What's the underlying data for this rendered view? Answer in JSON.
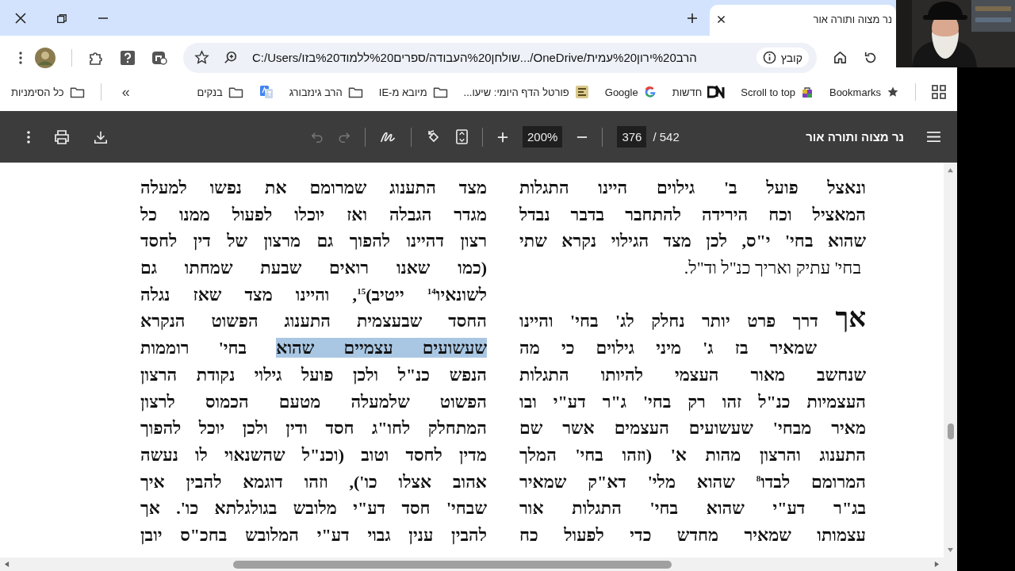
{
  "tabs": [
    {
      "title": "נר מצוה ותורה אור",
      "selected": true
    }
  ],
  "address_bar": {
    "site_chip": "קובץ",
    "url": "C:/Users/שולחן%20העבודה/ספרים%20ללמוד%20בזו.../OneDrive/הרב%20ירון%20עמית"
  },
  "bookmarks_bar": {
    "items": [
      {
        "kind": "star",
        "label": "Bookmarks"
      },
      {
        "kind": "bag",
        "label": "Scroll to top"
      },
      {
        "kind": "dn",
        "label": "חדשות"
      },
      {
        "kind": "google",
        "label": "Google"
      },
      {
        "kind": "daf",
        "label": "פורטל הדף היומי: שיעו..."
      },
      {
        "kind": "folder",
        "label": "מיובא מ-IE"
      },
      {
        "kind": "folder",
        "label": "הרב גינזבורג"
      },
      {
        "kind": "translate"
      },
      {
        "kind": "folder",
        "label": "בנקים"
      }
    ],
    "overflow": "»",
    "all_bookmarks": "כל הסימניות"
  },
  "pdf_toolbar": {
    "title": "נר מצוה ותורה אור",
    "page": "376",
    "page_count": "/ 542",
    "zoom": "200%",
    "undo": {
      "disabled": true
    },
    "redo": {
      "disabled": true
    }
  },
  "document": {
    "right_column": [
      {
        "kind": "justify",
        "text": "ונאצל פועל ב' גילוים היינו התגלות"
      },
      {
        "kind": "justify",
        "text": "המאציל וכח הירידה להתחבר בדבר נבדל"
      },
      {
        "kind": "justify",
        "text": "שהוא בחי' י\"ס, לכן מצד הגילוי נקרא שתי"
      },
      {
        "kind": "centered",
        "text": "בחי' עתיק ואריך כנ\"ל וד\"ל."
      },
      {
        "kind": "blank"
      },
      {
        "kind": "opening",
        "lead": "אך",
        "text": "דרך פרט יותר נחלק לג' בחי' והיינו"
      },
      {
        "kind": "indented",
        "text": "שמאיר בז ג' מיני גילוים כי מה"
      },
      {
        "kind": "justify",
        "text": "שנחשב מאור העצמי להיותו התגלות"
      },
      {
        "kind": "justify",
        "text": "העצמיות כנ\"ל זהו רק בחי' ג\"ר דע\"י ובו"
      },
      {
        "kind": "justify",
        "text": "מאיר מבחי' שעשועים העצמים אשר שם"
      },
      {
        "kind": "justify",
        "text": "התענוג והרצון מהות א' (וזהו בחי' המלך"
      },
      {
        "kind": "justify",
        "text": "המרומם לבדו$^{8}$ שהוא מלי' דא\"ק שמאיר"
      },
      {
        "kind": "justify",
        "text": "בג\"ר דע\"י שהוא בחי' התגלות אור"
      },
      {
        "kind": "justify",
        "text": "עצמותו שמאיר מחדש כדי לפעול כח"
      }
    ],
    "left_column": [
      {
        "kind": "justify",
        "text": "מצד התענוג שמרומם את נפשו למעלה"
      },
      {
        "kind": "justify",
        "text": "מגדר הגבלה ואז יוכלו לפעול ממנו כל"
      },
      {
        "kind": "justify",
        "text": "רצון דהיינו להפוך גם מרצון של דין לחסד"
      },
      {
        "kind": "justify",
        "text": "(כמו שאנו רואים שבעת שמחתו גם"
      },
      {
        "kind": "justify",
        "text": "לשונאיו$^{14}$ ייטיב)$^{15}$, והיינו מצד שאז נגלה"
      },
      {
        "kind": "justify",
        "text": "החסד שבעצמית התענוג הפשוט הנקרא"
      },
      {
        "kind": "parts",
        "parts": [
          {
            "text": "שעשועים עצמיים שהוא",
            "selected": true
          },
          {
            "text": "בחי' רוממות",
            "selected": false
          }
        ]
      },
      {
        "kind": "justify",
        "text": "הנפש כנ\"ל ולכן פועל גילוי נקודת הרצון"
      },
      {
        "kind": "justify",
        "text": "הפשוט שלמעלה מטעם הכמוס לרצון"
      },
      {
        "kind": "justify",
        "text": "המתחלק לחו\"ג חסד ודין ולכן יוכל להפוך"
      },
      {
        "kind": "justify",
        "text": "מדין לחסד וטוב (וכנ\"ל שהשנאוי לו נעשה"
      },
      {
        "kind": "justify",
        "text": "אהוב אצלו כו'), וזהו דוגמא להבין איך"
      },
      {
        "kind": "justify",
        "text": "שבחי' חסד דע\"י מלובש בגולגלתא כו'. אך"
      },
      {
        "kind": "justify",
        "text": "להבין ענין גבוי דע\"י המלובש בחכ\"ס יובן"
      }
    ]
  }
}
